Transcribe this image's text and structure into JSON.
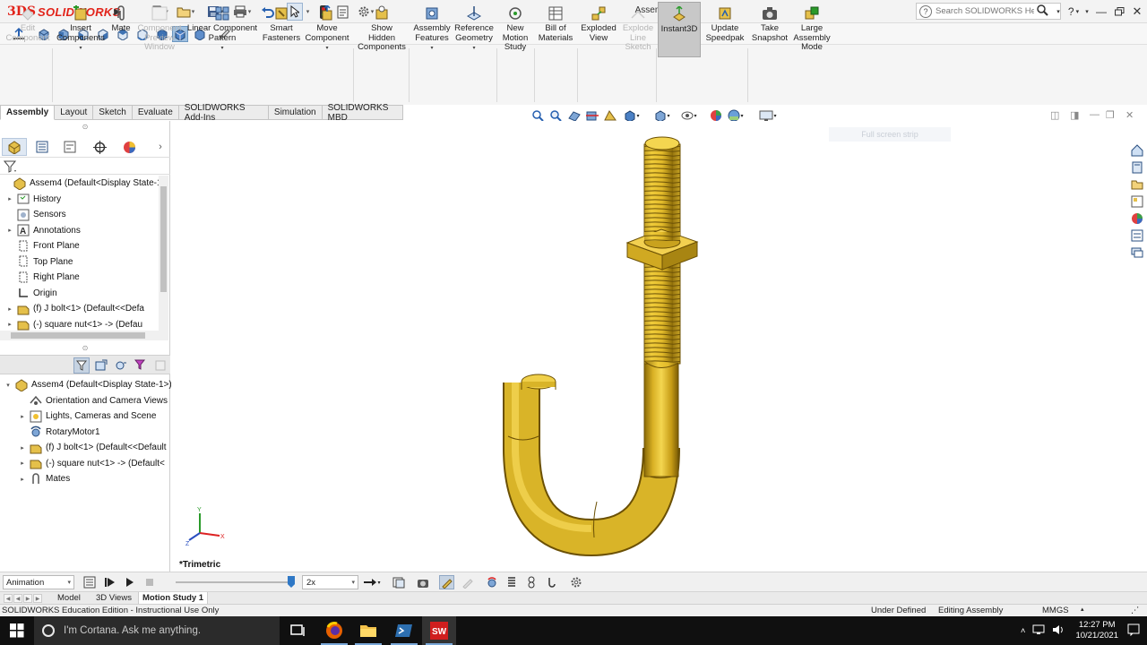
{
  "app": {
    "brand_prefix": "3DS",
    "brand": "SOLIDWORKS",
    "document_title": "Assem4 *"
  },
  "search": {
    "placeholder": "Search SOLIDWORKS Help"
  },
  "command_manager": [
    {
      "label": "Edit\nComponent",
      "disabled": true
    },
    {
      "label": "Insert\nComponents",
      "disabled": false,
      "dropdown": true
    },
    {
      "label": "Mate",
      "disabled": false
    },
    {
      "label": "Component\nPreview\nWindow",
      "disabled": true
    },
    {
      "label": "Linear Component\nPattern",
      "disabled": false,
      "dropdown": true
    },
    {
      "label": "Smart\nFasteners",
      "disabled": false
    },
    {
      "label": "Move\nComponent",
      "disabled": false,
      "dropdown": true
    },
    {
      "label": "Show\nHidden\nComponents",
      "disabled": false
    },
    {
      "label": "Assembly\nFeatures",
      "disabled": false,
      "dropdown": true
    },
    {
      "label": "Reference\nGeometry",
      "disabled": false,
      "dropdown": true
    },
    {
      "label": "New\nMotion\nStudy",
      "disabled": false
    },
    {
      "label": "Bill of\nMaterials",
      "disabled": false
    },
    {
      "label": "Exploded\nView",
      "disabled": false
    },
    {
      "label": "Explode\nLine\nSketch",
      "disabled": true
    },
    {
      "label": "Instant3D",
      "disabled": false,
      "active": true
    },
    {
      "label": "Update\nSpeedpak",
      "disabled": false
    },
    {
      "label": "Take\nSnapshot",
      "disabled": false
    },
    {
      "label": "Large\nAssembly\nMode",
      "disabled": false
    }
  ],
  "tabs": [
    "Assembly",
    "Layout",
    "Sketch",
    "Evaluate",
    "SOLIDWORKS Add-Ins",
    "Simulation",
    "SOLIDWORKS MBD"
  ],
  "active_tab": "Assembly",
  "feature_tree": [
    {
      "label": "Assem4  (Default<Display State-1>",
      "icon": "assembly-icon",
      "expander": "",
      "indent": 0
    },
    {
      "label": "History",
      "icon": "history-icon",
      "expander": "▸",
      "indent": 1
    },
    {
      "label": "Sensors",
      "icon": "sensors-icon",
      "expander": "",
      "indent": 1
    },
    {
      "label": "Annotations",
      "icon": "annotations-icon",
      "expander": "▸",
      "indent": 1
    },
    {
      "label": "Front Plane",
      "icon": "plane-icon",
      "expander": "",
      "indent": 1
    },
    {
      "label": "Top Plane",
      "icon": "plane-icon",
      "expander": "",
      "indent": 1
    },
    {
      "label": "Right Plane",
      "icon": "plane-icon",
      "expander": "",
      "indent": 1
    },
    {
      "label": "Origin",
      "icon": "origin-icon",
      "expander": "",
      "indent": 1
    },
    {
      "label": "(f) J bolt<1> (Default<<Defa",
      "icon": "part-icon",
      "expander": "▸",
      "indent": 1
    },
    {
      "label": "(-) square nut<1> -> (Defau",
      "icon": "part-icon",
      "expander": "▸",
      "indent": 1
    }
  ],
  "motion_tree": [
    {
      "label": "Assem4  (Default<Display State-1>)",
      "icon": "assembly-icon",
      "expander": "▾",
      "indent": 0
    },
    {
      "label": "Orientation and Camera Views",
      "icon": "camera-icon",
      "expander": "",
      "indent": 1
    },
    {
      "label": "Lights, Cameras and Scene",
      "icon": "lights-icon",
      "expander": "▸",
      "indent": 1
    },
    {
      "label": "RotaryMotor1",
      "icon": "motor-icon",
      "expander": "",
      "indent": 1
    },
    {
      "label": "(f) J bolt<1> (Default<<Default",
      "icon": "part-icon",
      "expander": "▸",
      "indent": 1
    },
    {
      "label": "(-) square nut<1> -> (Default<",
      "icon": "part-icon",
      "expander": "▸",
      "indent": 1
    },
    {
      "label": "Mates",
      "icon": "mates-icon",
      "expander": "▸",
      "indent": 1
    }
  ],
  "graphics": {
    "view_label": "*Trimetric",
    "full_screen_tip": "Full screen strip",
    "triad": {
      "x": "X",
      "y": "Y",
      "z": "Z"
    },
    "model_color": "#e8c83a"
  },
  "motion_bar": {
    "study_type": "Animation",
    "playback_speed": "2x",
    "timeline_position": 1.0
  },
  "bottom_tabs": [
    "Model",
    "3D Views",
    "Motion Study 1"
  ],
  "active_bottom_tab": "Motion Study 1",
  "status": {
    "edition": "SOLIDWORKS Education Edition - Instructional Use Only",
    "definition": "Under Defined",
    "mode": "Editing Assembly",
    "units": "MMGS"
  },
  "taskbar": {
    "cortana_placeholder": "I'm Cortana. Ask me anything.",
    "time": "12:27 PM",
    "date": "10/21/2021",
    "sw_badge": "SW"
  },
  "colors": {
    "brand_red": "#e2231a",
    "accent_blue": "#2f78c6",
    "taskbar": "#101010"
  }
}
